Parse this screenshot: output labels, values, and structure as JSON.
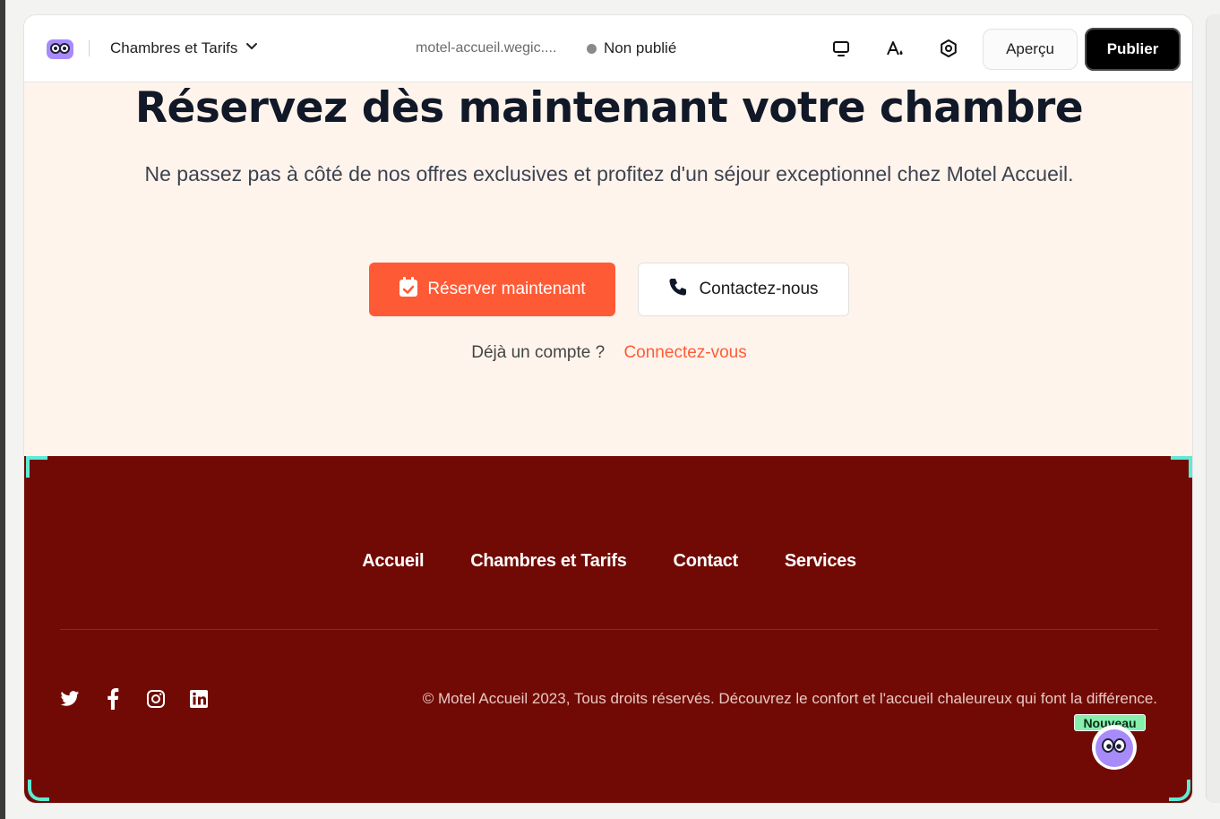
{
  "colors": {
    "accent": "#ff5a36",
    "hero_bg": "#fff4ec",
    "footer_bg": "#710a04",
    "publish_btn": "#000000",
    "badge": "#86efac"
  },
  "topbar": {
    "logo_icon": "owl-logo-icon",
    "page_selector": "Chambres et Tarifs",
    "site_url": "motel-accueil.wegic....",
    "status": "Non publié",
    "icons": [
      "desktop-icon",
      "text-color-icon",
      "settings-gear-icon"
    ],
    "preview_label": "Aperçu",
    "publish_label": "Publier"
  },
  "hero": {
    "title": "Réservez dès maintenant votre chambre",
    "subtitle": "Ne passez pas à côté de nos offres exclusives et profitez d'un séjour exceptionnel chez Motel Accueil.",
    "reserve_label": "Réserver maintenant",
    "contact_label": "Contactez-nous",
    "account_question": "Déjà un compte ?",
    "login_link": "Connectez-vous"
  },
  "footer": {
    "nav": [
      "Accueil",
      "Chambres et Tarifs",
      "Contact",
      "Services"
    ],
    "socials": [
      "twitter-icon",
      "facebook-icon",
      "instagram-icon",
      "linkedin-icon"
    ],
    "copyright": "© Motel Accueil 2023, Tous droits réservés. Découvrez le confort et l'accueil chaleureux qui font la différence."
  },
  "assistant": {
    "badge": "Nouveau"
  }
}
